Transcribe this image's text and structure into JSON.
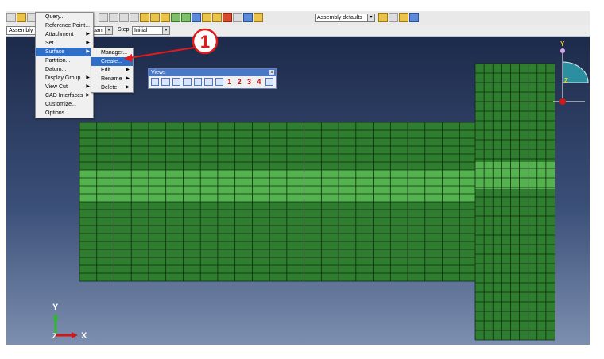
{
  "toolbar": {
    "render_style_label": "Assembly defaults",
    "tool_icons": [
      "query-tool-icon",
      "select-icon",
      "pan-icon",
      "rotate-icon",
      "zoom-icon",
      "box-zoom-icon",
      "view-icon",
      "render-icon",
      "color-icon",
      "info-icon",
      "translucency-icon",
      "undo-icon",
      "redo-icon",
      "csys-icon"
    ]
  },
  "context": {
    "module_label": "Assembly",
    "model_value": "uan",
    "step_label": "Step:",
    "step_value": "Initial"
  },
  "tools_menu": {
    "items": [
      {
        "label": "Query..."
      },
      {
        "label": "Reference Point..."
      },
      {
        "label": "Attachment",
        "submenu": true
      },
      {
        "label": "Set",
        "submenu": true
      },
      {
        "label": "Surface",
        "submenu": true,
        "highlighted": true
      },
      {
        "label": "Partition..."
      },
      {
        "label": "Datum..."
      },
      {
        "label": "Display Group",
        "submenu": true
      },
      {
        "label": "View Cut",
        "submenu": true
      },
      {
        "label": "CAD Interfaces",
        "submenu": true
      },
      {
        "label": "Customize..."
      },
      {
        "label": "Options..."
      }
    ]
  },
  "surface_menu": {
    "items": [
      {
        "label": "Manager..."
      },
      {
        "label": "Create...",
        "highlighted": true
      },
      {
        "label": "Edit",
        "submenu": true
      },
      {
        "label": "Rename",
        "submenu": true
      },
      {
        "label": "Delete",
        "submenu": true
      }
    ]
  },
  "views_toolbar": {
    "title": "Views",
    "close_label": "x",
    "numbers": [
      "1",
      "2",
      "3",
      "4"
    ]
  },
  "annotation": {
    "marker_label": "1"
  },
  "triad": {
    "x_label": "X",
    "y_label": "Y",
    "z_label": "Z"
  },
  "mini_triad": {
    "y_label": "Y",
    "z_label": "Z"
  },
  "colors": {
    "mesh_dark": "#2f7d2f",
    "mesh_band": "#55b34f",
    "annotation": "#e21a1a",
    "menu_highlight": "#2f6fc7"
  }
}
